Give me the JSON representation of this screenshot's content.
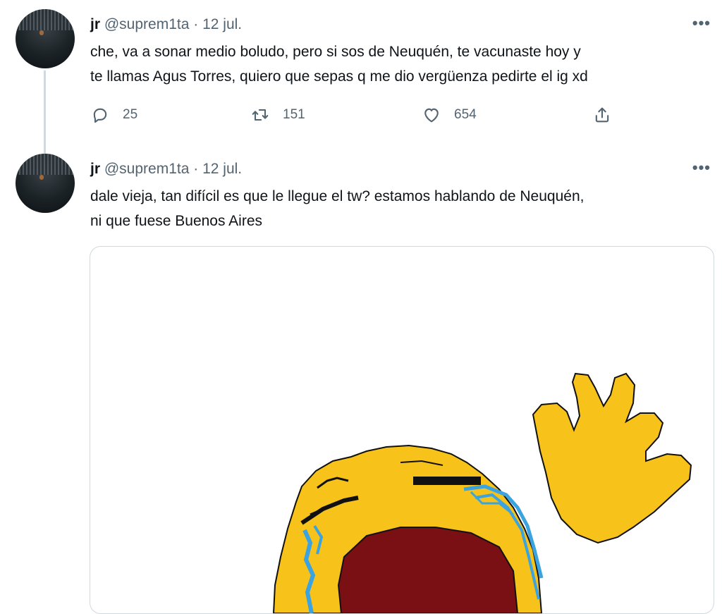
{
  "tweets": [
    {
      "name": "jr",
      "handle": "@suprem1ta",
      "separator": "·",
      "date": "12 jul.",
      "more": "•••",
      "lines": [
        "che, va a sonar medio boludo, pero si sos de Neuquén, te vacunaste hoy y",
        "te llamas Agus Torres, quiero que sepas q me dio vergüenza pedirte el ig xd"
      ],
      "reply_count": "25",
      "retweet_count": "151",
      "like_count": "654"
    },
    {
      "name": "jr",
      "handle": "@suprem1ta",
      "separator": "·",
      "date": "12 jul.",
      "more": "•••",
      "lines": [
        "dale vieja, tan difícil es que le llegue el tw? estamos hablando de Neuquén,",
        "ni que fuese Buenos Aires"
      ]
    }
  ],
  "icons": {
    "reply": "reply-icon",
    "retweet": "retweet-icon",
    "like": "heart-icon",
    "share": "share-icon"
  },
  "media": {
    "description_icon": "crying-emoji-image"
  },
  "colors": {
    "text": "#0f1419",
    "secondary": "#536471",
    "border": "#cfd9de",
    "emoji_yellow": "#f7c21a",
    "mouth": "#7a0f14",
    "tears": "#3aa3e0"
  }
}
